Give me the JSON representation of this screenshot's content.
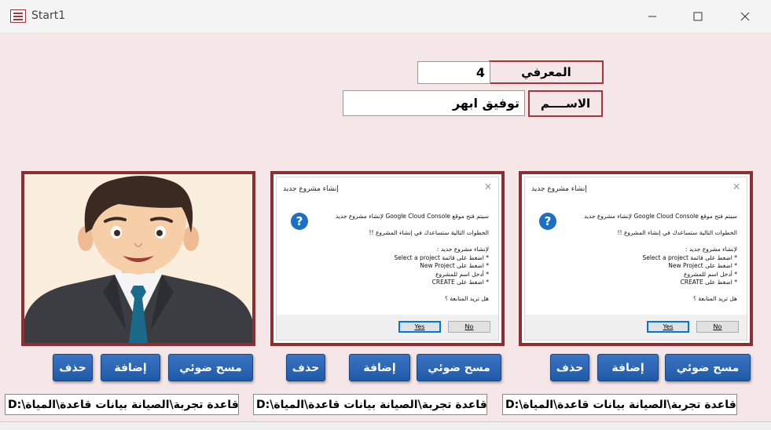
{
  "window": {
    "title": "Start1"
  },
  "form": {
    "id_label": "المعرفي",
    "id_value": "4",
    "name_label": "الاســــم",
    "name_value": "توفيق ابهر"
  },
  "dialog": {
    "title": "إنشاء مشروع جديد",
    "lines": [
      "سيتم فتح موقع Google Cloud Console لإنشاء مشروع جديد",
      "",
      "الخطوات التالية ستساعدك في إنشاء المشروع !!",
      "",
      "لإنشاء مشروع جديد :",
      "* اضغط على قائمة Select a project",
      "* اضغط على New Project",
      "* أدخل اسم للمشروع",
      "* اضغط على CREATE",
      "",
      "هل تريد المتابعة ؟"
    ],
    "yes": "Yes",
    "no": "No"
  },
  "buttons": {
    "scan": "مسح ضوئي",
    "add": "إضافة",
    "delete": "حذف"
  },
  "paths": [
    "D:\\بيانات قاعدة تجربة\\الصيانة بيانات قاعدة\\المياة",
    "D:\\بيانات قاعدة تجربة\\الصيانة بيانات قاعدة\\المياة",
    "D:\\بيانات قاعدة تجربة\\الصيانة بيانات قاعدة\\المياة"
  ],
  "colors": {
    "background": "#f5e6e7",
    "frame": "#a5363e",
    "button": "#2a64b5"
  }
}
